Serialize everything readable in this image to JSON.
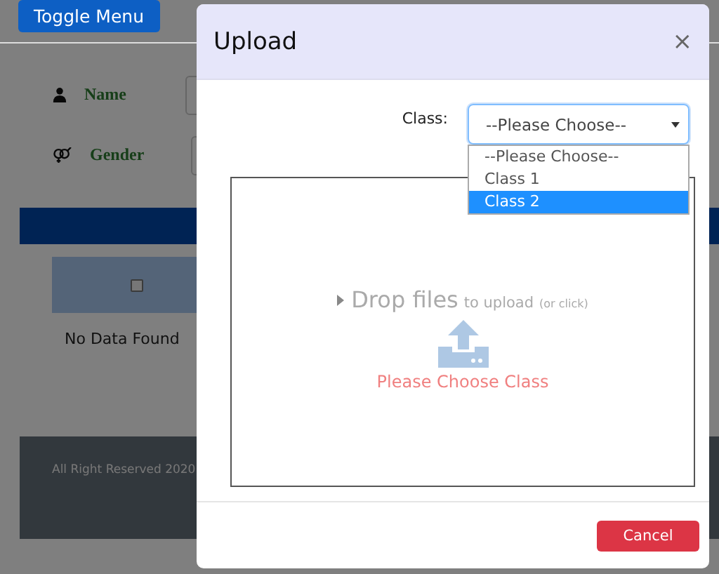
{
  "toggle_button": "Toggle Menu",
  "fields": [
    {
      "kind": "person",
      "label": "Name"
    },
    {
      "kind": "gender",
      "label": "Gender"
    }
  ],
  "table": {
    "header_checkbox": {
      "checked": false
    },
    "empty_text": "No Data Found"
  },
  "footer": "All Right Reserved 2020",
  "modal": {
    "title": "Upload",
    "close": "×",
    "class_label": "Class:",
    "select_value": "--Please Choose--",
    "options": [
      {
        "label": "--Please Choose--",
        "selected": false
      },
      {
        "label": "Class 1",
        "selected": false
      },
      {
        "label": "Class 2",
        "selected": true
      }
    ],
    "dropzone": {
      "title": "Drop files",
      "hint": "to upload",
      "note": "(or click)",
      "error": "Please Choose Class"
    },
    "cancel": "Cancel"
  }
}
